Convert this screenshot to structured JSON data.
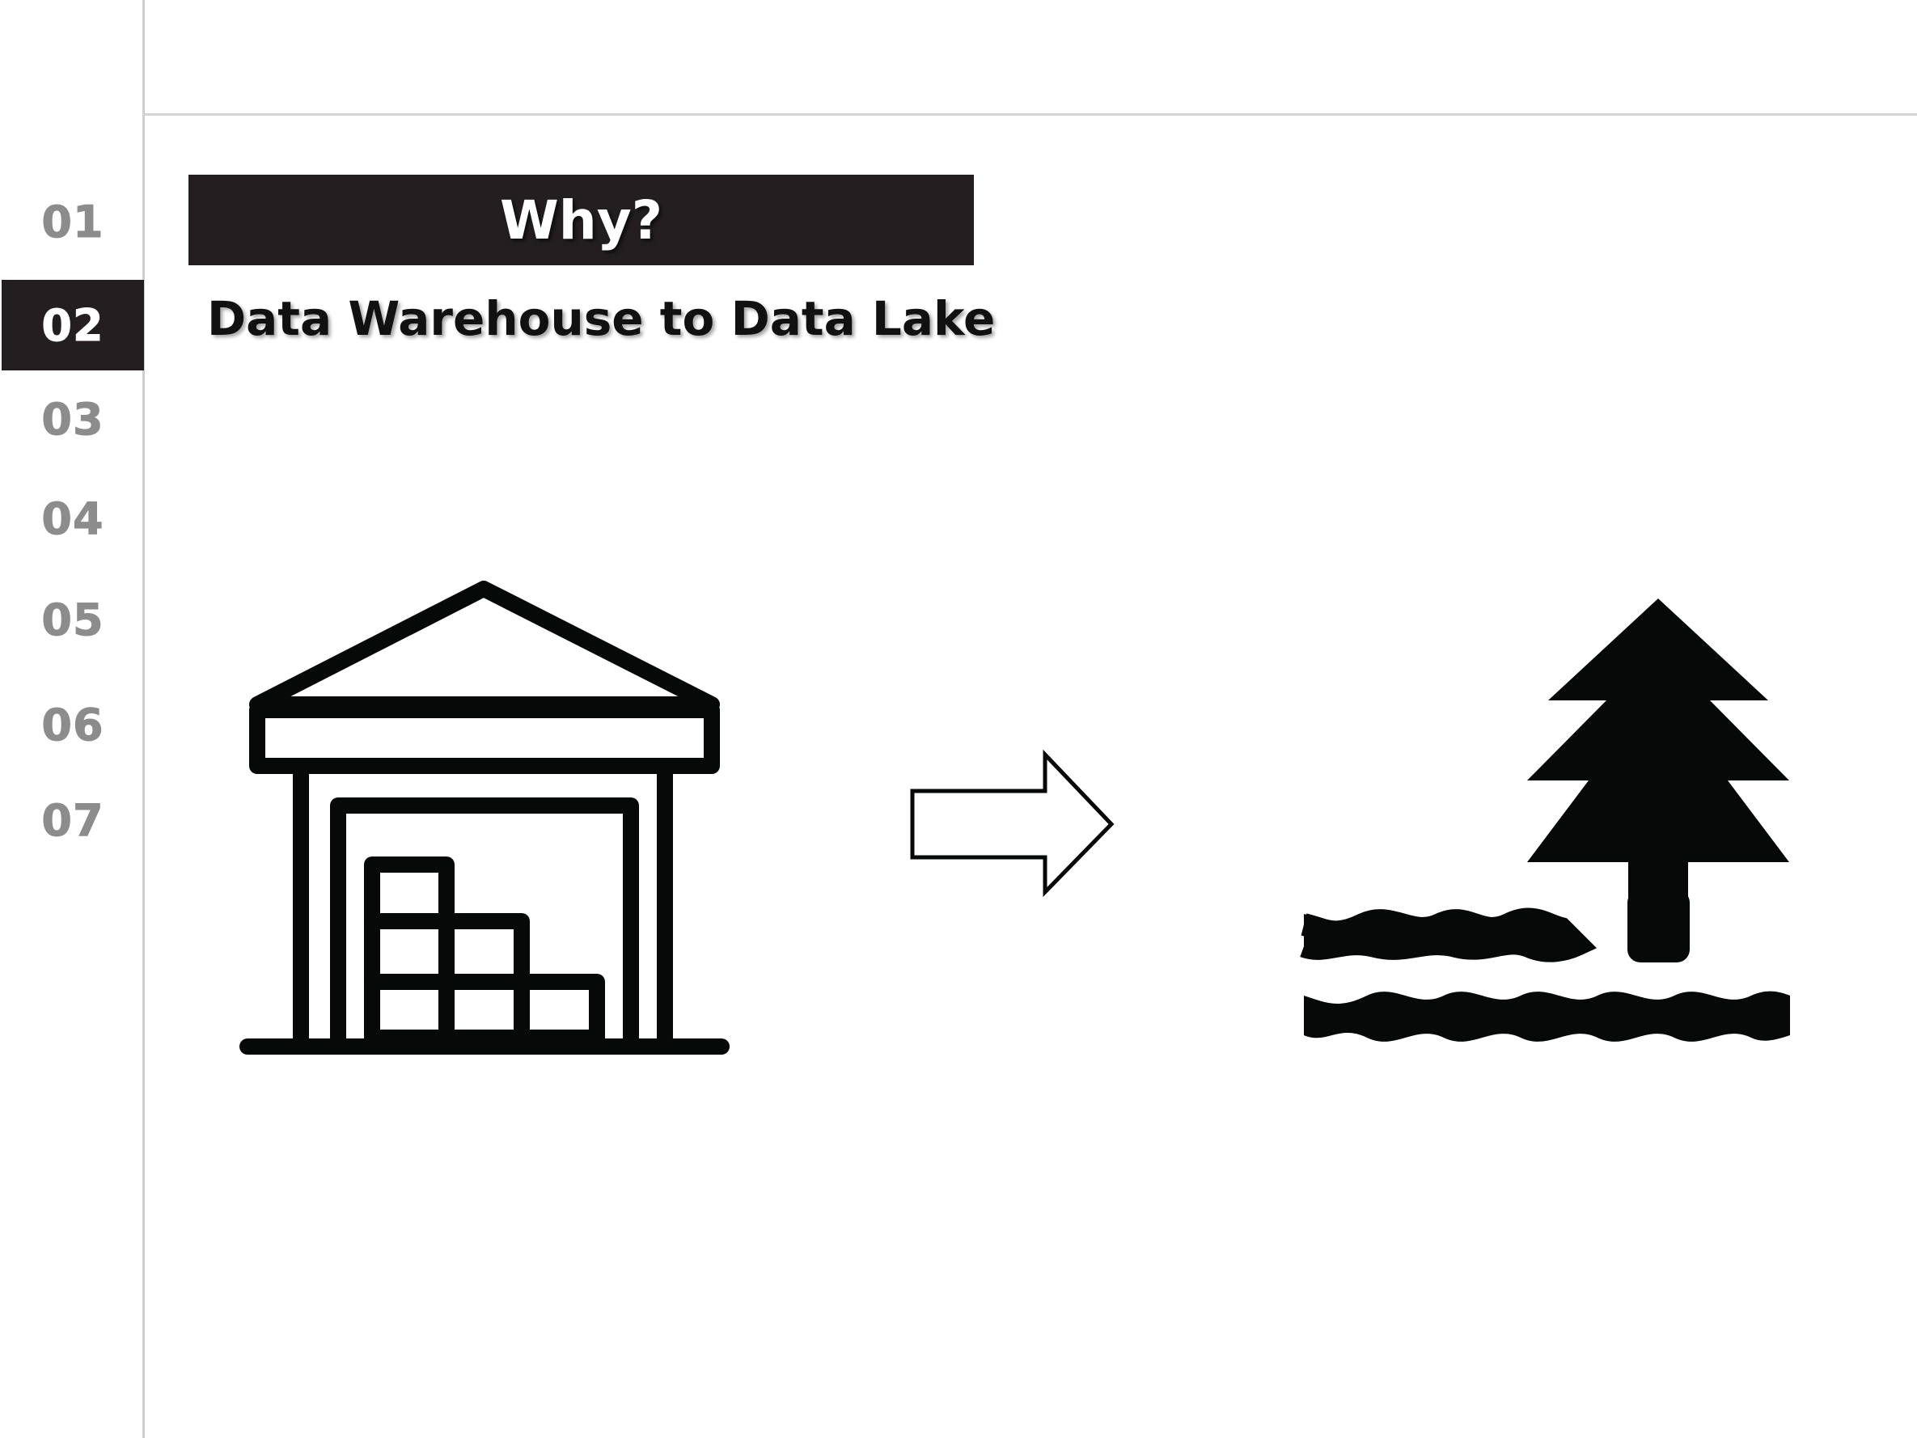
{
  "nav": {
    "items": [
      {
        "label": "01",
        "active": false
      },
      {
        "label": "02",
        "active": true
      },
      {
        "label": "03",
        "active": false
      },
      {
        "label": "04",
        "active": false
      },
      {
        "label": "05",
        "active": false
      },
      {
        "label": "06",
        "active": false
      },
      {
        "label": "07",
        "active": false
      }
    ]
  },
  "slide": {
    "title": "Why?",
    "subtitle": "Data Warehouse to Data Lake"
  },
  "icons": {
    "left": "warehouse-icon",
    "middle": "right-arrow-icon",
    "right": "lake-tree-icon"
  },
  "colors": {
    "accent": "#231f20",
    "nav_inactive": "#8c8c8c",
    "divider": "#d3d3d3",
    "icon": "#060908"
  }
}
